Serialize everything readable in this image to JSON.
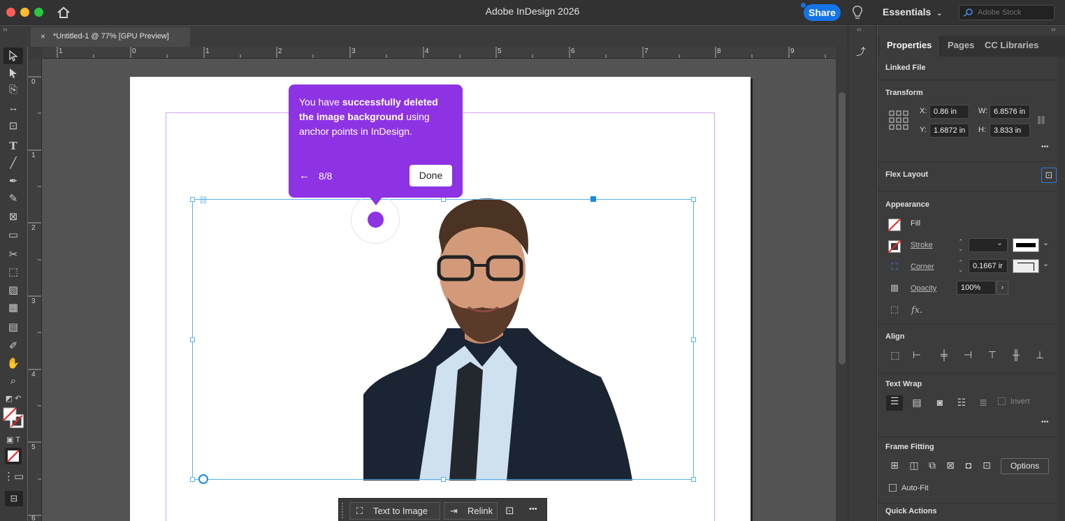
{
  "window": {
    "title": "Adobe InDesign 2026",
    "share_label": "Share",
    "workspace": "Essentials",
    "stock_placeholder": "Adobe Stock"
  },
  "document_tab": {
    "title": "*Untitled-1 @ 77% [GPU Preview]",
    "close": "×"
  },
  "rulers": {
    "horizontal": [
      "1",
      "0",
      "1",
      "2",
      "3",
      "4",
      "5",
      "6",
      "7",
      "8",
      "9"
    ],
    "vertical": [
      "0",
      "1",
      "2",
      "3",
      "4",
      "5",
      "6"
    ]
  },
  "tooltip": {
    "text_1": "You have ",
    "text_bold": "successfully deleted the image background",
    "text_2": " using anchor points in InDesign.",
    "back_icon": "←",
    "step": "8/8",
    "done_label": "Done"
  },
  "taskbar": {
    "text_to_image": "Text to Image",
    "relink": "Relink",
    "more": "•••"
  },
  "panel": {
    "tabs": [
      "Properties",
      "Pages",
      "CC Libraries"
    ],
    "linked_file": "Linked File",
    "transform": {
      "heading": "Transform",
      "x_label": "X:",
      "x_value": "0.86 in",
      "y_label": "Y:",
      "y_value": "1.6872 in",
      "w_label": "W:",
      "w_value": "6.8576 in",
      "h_label": "H:",
      "h_value": "3.833 in"
    },
    "flex_layout": "Flex Layout",
    "appearance": {
      "heading": "Appearance",
      "fill": "Fill",
      "stroke": "Stroke",
      "corner": "Corner",
      "corner_value": "0.1667 ir",
      "opacity": "Opacity",
      "opacity_value": "100%",
      "fx": "fx."
    },
    "align": "Align",
    "text_wrap": {
      "heading": "Text Wrap",
      "invert": "Invert"
    },
    "frame_fitting": {
      "heading": "Frame Fitting",
      "options": "Options",
      "autofit": "Auto-Fit"
    },
    "quick_actions": "Quick Actions",
    "more": "•••"
  },
  "colors": {
    "accent_purple": "#8e33e3",
    "share_blue": "#1473e6",
    "frame_blue": "#59b3ee",
    "margin_violet": "#d7a4ec"
  }
}
